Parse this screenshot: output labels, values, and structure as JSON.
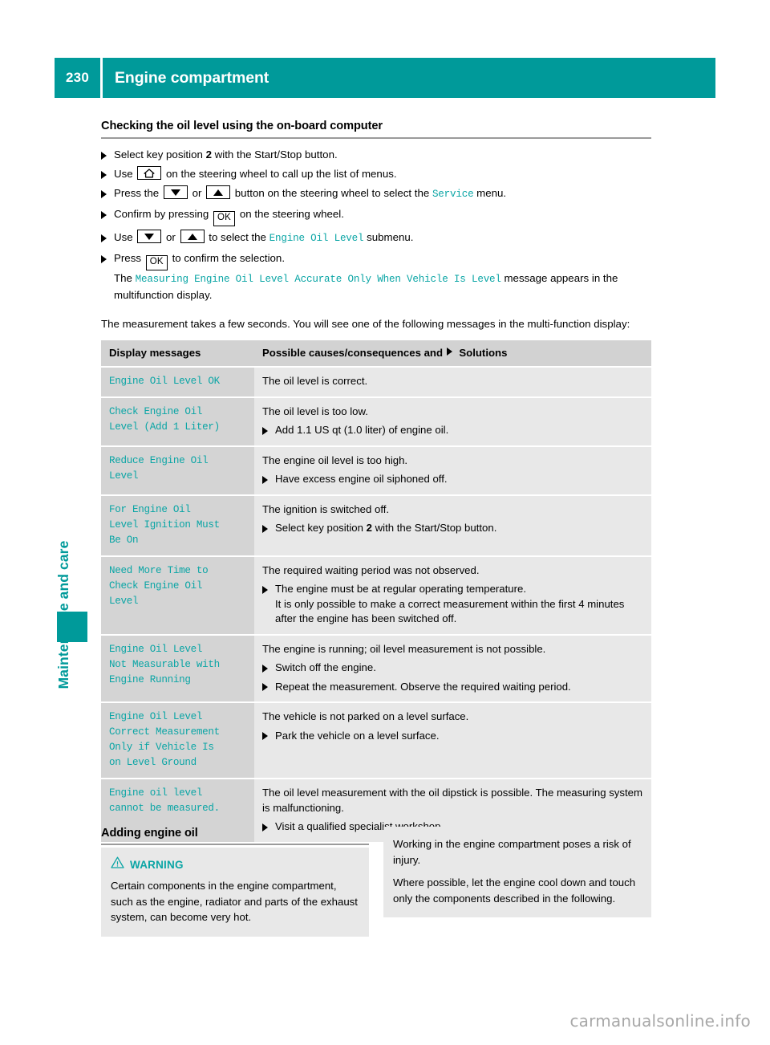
{
  "header": {
    "page_number": "230",
    "title": "Engine compartment"
  },
  "side_tab": {
    "label": "Maintenance and care"
  },
  "section": {
    "heading": "Checking the oil level using the on-board computer",
    "steps": [
      {
        "pre": "Select key position ",
        "bold": "2",
        "post": " with the Start/Stop button."
      },
      {
        "pre": "Use ",
        "key": "home-icon",
        "post": " on the steering wheel to call up the list of menus."
      },
      {
        "pre": "Press the ",
        "key1": "arrow-down-icon",
        "mid": " or ",
        "key2": "arrow-up-icon",
        "post": " button on the steering wheel to select the ",
        "mono": "Service",
        "tail": " menu."
      },
      {
        "pre": "Confirm by pressing ",
        "key": "OK",
        "post": " on the steering wheel."
      },
      {
        "pre": "Use ",
        "key1": "arrow-down-icon",
        "mid": " or ",
        "key2": "arrow-up-icon",
        "post": " to select the ",
        "mono": "Engine Oil Level",
        "tail": " submenu."
      },
      {
        "pre": "Press ",
        "key": "OK",
        "post": " to confirm the selection.",
        "sub_pre": "The ",
        "sub_mono": "Measuring Engine Oil Level Accurate Only When Vehicle Is Level",
        "sub_post": " message appears in the multifunction display."
      }
    ],
    "intro_paragraph": "The measurement takes a few seconds. You will see one of the following messages in the multi-function display:"
  },
  "table": {
    "headers": {
      "col_a": "Display messages",
      "col_b_pre": "Possible causes/consequences and ",
      "col_b_post": " Solutions"
    },
    "rows": [
      {
        "message": [
          "Engine Oil Level OK"
        ],
        "lines": [
          {
            "type": "text",
            "text": "The oil level is correct."
          }
        ]
      },
      {
        "message": [
          "Check Engine Oil",
          "Level (Add 1 Liter)"
        ],
        "lines": [
          {
            "type": "text",
            "text": "The oil level is too low."
          },
          {
            "type": "bullet",
            "text": "Add 1.1 US qt (1.0 liter) of engine oil."
          }
        ]
      },
      {
        "message": [
          "Reduce Engine Oil",
          "Level"
        ],
        "lines": [
          {
            "type": "text",
            "text": "The engine oil level is too high."
          },
          {
            "type": "bullet",
            "text": "Have excess engine oil siphoned off."
          }
        ]
      },
      {
        "message": [
          "For Engine Oil",
          "Level Ignition Must",
          "Be On"
        ],
        "lines": [
          {
            "type": "text",
            "text": "The ignition is switched off."
          },
          {
            "type": "bullet-bold2",
            "pre": "Select key position ",
            "bold": "2",
            "post": " with the Start/Stop button."
          }
        ]
      },
      {
        "message": [
          "Need More Time to",
          "Check Engine Oil",
          "Level"
        ],
        "lines": [
          {
            "type": "text",
            "text": "The required waiting period was not observed."
          },
          {
            "type": "bullet",
            "text": "The engine must be at regular operating temperature."
          },
          {
            "type": "cont",
            "text": "It is only possible to make a correct measurement within the first 4 minutes after the engine has been switched off."
          }
        ]
      },
      {
        "message": [
          "Engine Oil Level",
          "Not Measurable with",
          "Engine Running"
        ],
        "lines": [
          {
            "type": "text",
            "text": "The engine is running; oil level measurement is not possible."
          },
          {
            "type": "bullet",
            "text": "Switch off the engine."
          },
          {
            "type": "bullet",
            "text": "Repeat the measurement. Observe the required waiting period."
          }
        ]
      },
      {
        "message": [
          "Engine Oil Level",
          "Correct Measurement",
          "Only if Vehicle Is",
          "on Level Ground"
        ],
        "lines": [
          {
            "type": "text",
            "text": "The vehicle is not parked on a level surface."
          },
          {
            "type": "bullet",
            "text": "Park the vehicle on a level surface."
          }
        ]
      },
      {
        "message": [
          "Engine oil level",
          "cannot be measured."
        ],
        "lines": [
          {
            "type": "text",
            "text": "The oil level measurement with the oil dipstick is possible. The measuring system is malfunctioning."
          },
          {
            "type": "bullet",
            "text": "Visit a qualified specialist workshop."
          }
        ]
      }
    ]
  },
  "bottom": {
    "sub_heading": "Adding engine oil",
    "warning_label": "WARNING",
    "warning_text": "Certain components in the engine compartment, such as the engine, radiator and parts of the exhaust system, can become very hot.",
    "continued_paragraph_1": "Working in the engine compartment poses a risk of injury.",
    "continued_paragraph_2": "Where possible, let the engine cool down and touch only the components described in the following."
  },
  "watermark": "carmanualsonline.info",
  "colors": {
    "teal": "#009a9a",
    "teal_mono": "#0aa5a5",
    "header_gray": "#d2d2d2",
    "cell_a_gray": "#d4d4d4",
    "cell_b_gray": "#e8e8e8"
  }
}
